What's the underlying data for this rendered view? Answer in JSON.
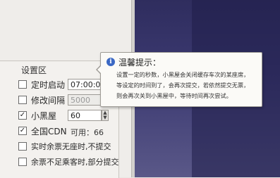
{
  "panel": {
    "title": "设置区"
  },
  "rows": {
    "timer": {
      "label": "定时启动",
      "value": "07:00:01",
      "checked": false
    },
    "interval": {
      "label": "修改间隔",
      "value": "5000",
      "checked": false
    },
    "blackhouse": {
      "label": "小黑屋",
      "value": "60",
      "checked": true
    },
    "cdn": {
      "label": "全国CDN",
      "available": "可用：66",
      "checked": true
    },
    "realtime": {
      "label": "实时余票无座时,不提交",
      "checked": false
    },
    "insufficient": {
      "label": "余票不足乘客时,部分提交",
      "checked": false
    }
  },
  "tooltip": {
    "title": "温馨提示：",
    "lines": [
      "设置一定的秒数，小黑屋会关闭缓存车次的某座席，",
      "等设定的时间到了，会再次提交，若依然提交无票，",
      "则会再次关到小黑屋中，等待时间再次尝试。"
    ]
  },
  "symbols": {
    "check": "✓",
    "up": "▲",
    "down": "▼",
    "info": "i"
  }
}
